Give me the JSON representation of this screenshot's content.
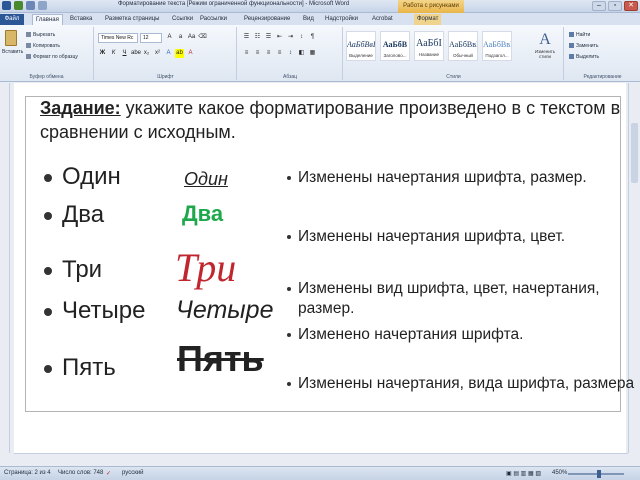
{
  "window": {
    "title": "Форматирование текста [Режим ограниченной функциональности] - Microsoft Word",
    "context_title": "Работа с рисунками",
    "min": "–",
    "max": "▫",
    "close": "✕"
  },
  "ribbon_tabs": {
    "file": "Файл",
    "home": "Главная",
    "insert": "Вставка",
    "layout": "Разметка страницы",
    "refs": "Ссылки",
    "mailings": "Рассылки",
    "review": "Рецензирование",
    "view": "Вид",
    "addins": "Надстройки",
    "acrobat": "Acrobat",
    "format": "Формат"
  },
  "clipboard": {
    "paste": "Вставить",
    "cut": "Вырезать",
    "copy": "Копировать",
    "format_painter": "Формат по образцу",
    "label": "Буфер обмена"
  },
  "font_group": {
    "font_name": "Times New Rc",
    "font_size": "12",
    "label": "Шрифт"
  },
  "paragraph_group": {
    "label": "Абзац"
  },
  "styles_group": {
    "label": "Стили",
    "change_styles": "Изменить стили",
    "items": [
      {
        "sample": "АаБбВвГ",
        "name": "Выделение"
      },
      {
        "sample": "АаБбВ",
        "name": "Заголово..."
      },
      {
        "sample": "АаБбІ",
        "name": "Название"
      },
      {
        "sample": "АаБбВвІ",
        "name": "Обычный"
      },
      {
        "sample": "АаБбВвІ",
        "name": "Подзагол..."
      }
    ]
  },
  "editing_group": {
    "find": "Найти",
    "replace": "Заменить",
    "select": "Выделить",
    "label": "Редактирование"
  },
  "document": {
    "task_bold": "Задание:",
    "task_rest": " укажите какое форматирование произведено в с текстом в сравнении с исходным.",
    "originals": [
      "Один",
      "Два",
      "Три",
      "Четыре",
      "Пять"
    ],
    "formatted": [
      "Один",
      "Два",
      "Три",
      "Четыре",
      "Пять"
    ],
    "answers": [
      "Изменены начертания шрифта, размер.",
      "Изменены начертания шрифта, цвет.",
      "Изменены вид шрифта, цвет, начертания, размер.",
      "Изменено начертания шрифта.",
      "Изменены начертания, вида шрифта, размера"
    ]
  },
  "status_bar": {
    "page": "Страница: 2 из 4",
    "words": "Число слов: 748",
    "language": "русский",
    "zoom": "450%",
    "zoom_fraction": 0.55
  }
}
